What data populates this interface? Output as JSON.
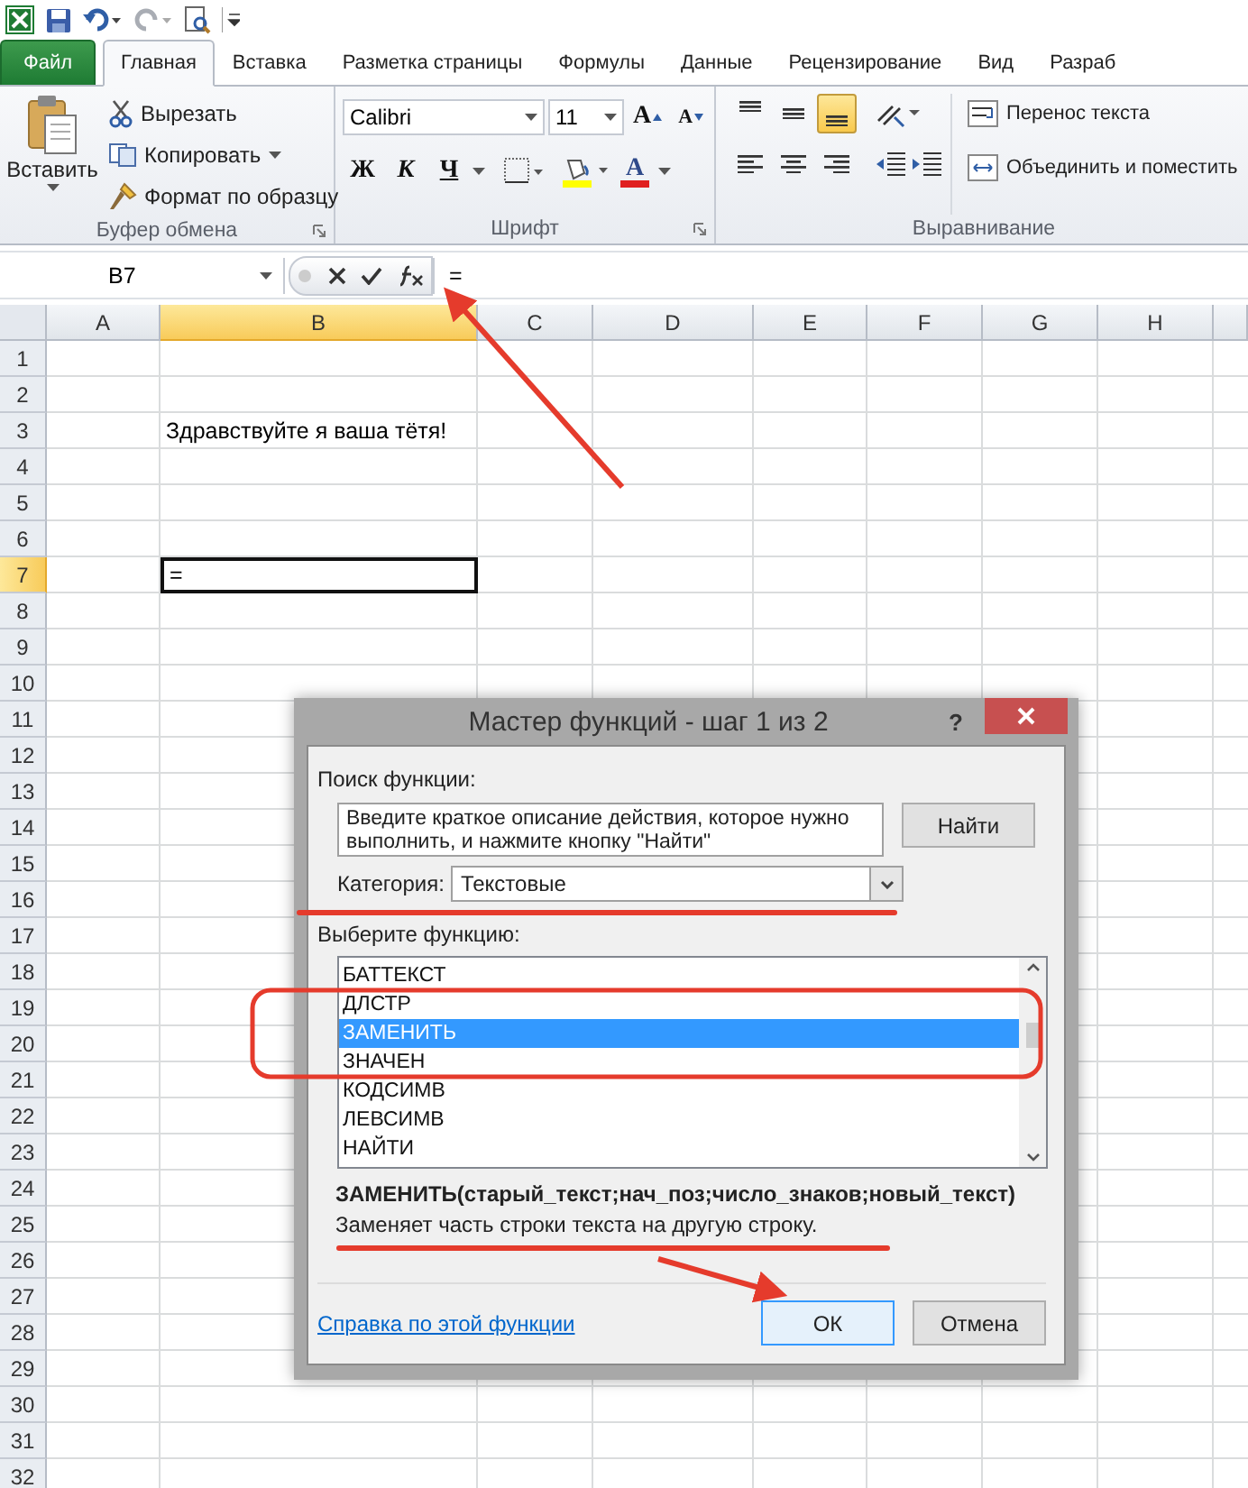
{
  "tabs": [
    {
      "label": "Файл",
      "kind": "file",
      "selected": false
    },
    {
      "label": "Главная",
      "kind": "tab",
      "selected": true
    },
    {
      "label": "Вставка",
      "kind": "tab",
      "selected": false
    },
    {
      "label": "Разметка страницы",
      "kind": "tab",
      "selected": false
    },
    {
      "label": "Формулы",
      "kind": "tab",
      "selected": false
    },
    {
      "label": "Данные",
      "kind": "tab",
      "selected": false
    },
    {
      "label": "Рецензирование",
      "kind": "tab",
      "selected": false
    },
    {
      "label": "Вид",
      "kind": "tab",
      "selected": false
    },
    {
      "label": "Разраб",
      "kind": "tab",
      "selected": false
    }
  ],
  "clipboard": {
    "title": "Буфер обмена",
    "paste": "Вставить",
    "cut": "Вырезать",
    "copy": "Копировать",
    "format_painter": "Формат по образцу"
  },
  "font": {
    "title": "Шрифт",
    "name": "Calibri",
    "size": "11",
    "grow_glyph": "A",
    "shrink_glyph": "A",
    "bold": "Ж",
    "italic": "К",
    "underline": "Ч",
    "color_glyph": "A"
  },
  "alignment": {
    "title": "Выравнивание",
    "vertical": [
      {
        "kind": "top",
        "selected": false
      },
      {
        "kind": "middle",
        "selected": false
      },
      {
        "kind": "bottom",
        "selected": true
      }
    ],
    "wrap": "Перенос текста",
    "merge": "Объединить и поместить"
  },
  "formula_bar": {
    "name_box": "B7",
    "formula": "="
  },
  "columns": [
    {
      "label": "A",
      "selected": false
    },
    {
      "label": "B",
      "selected": true
    },
    {
      "label": "C",
      "selected": false
    },
    {
      "label": "D",
      "selected": false
    },
    {
      "label": "E",
      "selected": false
    },
    {
      "label": "F",
      "selected": false
    },
    {
      "label": "G",
      "selected": false
    },
    {
      "label": "H",
      "selected": false
    }
  ],
  "rows": [
    {
      "label": "1",
      "selected": false
    },
    {
      "label": "2",
      "selected": false
    },
    {
      "label": "3",
      "selected": false,
      "cells": {
        "b": "Здравствуйте я ваша тётя!"
      }
    },
    {
      "label": "4",
      "selected": false
    },
    {
      "label": "5",
      "selected": false
    },
    {
      "label": "6",
      "selected": false
    },
    {
      "label": "7",
      "selected": true,
      "cells": {
        "b": "="
      }
    },
    {
      "label": "8",
      "selected": false
    },
    {
      "label": "9",
      "selected": false
    },
    {
      "label": "10",
      "selected": false
    },
    {
      "label": "11",
      "selected": false
    },
    {
      "label": "12",
      "selected": false
    },
    {
      "label": "13",
      "selected": false
    },
    {
      "label": "14",
      "selected": false
    },
    {
      "label": "15",
      "selected": false
    },
    {
      "label": "16",
      "selected": false
    },
    {
      "label": "17",
      "selected": false
    },
    {
      "label": "18",
      "selected": false
    },
    {
      "label": "19",
      "selected": false
    },
    {
      "label": "20",
      "selected": false
    },
    {
      "label": "21",
      "selected": false
    },
    {
      "label": "22",
      "selected": false
    },
    {
      "label": "23",
      "selected": false
    },
    {
      "label": "24",
      "selected": false
    },
    {
      "label": "25",
      "selected": false
    },
    {
      "label": "26",
      "selected": false
    },
    {
      "label": "27",
      "selected": false
    },
    {
      "label": "28",
      "selected": false
    },
    {
      "label": "29",
      "selected": false
    },
    {
      "label": "30",
      "selected": false
    },
    {
      "label": "31",
      "selected": false
    },
    {
      "label": "32",
      "selected": false
    }
  ],
  "dialog": {
    "title": "Мастер функций - шаг 1 из 2",
    "help": "?",
    "search_label": "Поиск функции:",
    "search_value": "Введите краткое описание действия, которое нужно выполнить, и нажмите кнопку \"Найти\"",
    "find_button": "Найти",
    "category_label": "Категория:",
    "category": "Текстовые",
    "list_label": "Выберите функцию:",
    "functions": [
      {
        "label": "БАТТЕКСТ",
        "selected": false
      },
      {
        "label": "ДЛСТР",
        "selected": false
      },
      {
        "label": "ЗАМЕНИТЬ",
        "selected": true
      },
      {
        "label": "ЗНАЧЕН",
        "selected": false
      },
      {
        "label": "КОДСИМВ",
        "selected": false
      },
      {
        "label": "ЛЕВСИМВ",
        "selected": false
      },
      {
        "label": "НАЙТИ",
        "selected": false
      }
    ],
    "signature": "ЗАМЕНИТЬ(старый_текст;нач_поз;число_знаков;новый_текст)",
    "description": "Заменяет часть строки текста на другую строку.",
    "help_link": "Справка по этой функции",
    "buttons": [
      {
        "label": "ОК",
        "kind": "default"
      },
      {
        "label": "Отмена",
        "kind": "normal"
      }
    ]
  }
}
